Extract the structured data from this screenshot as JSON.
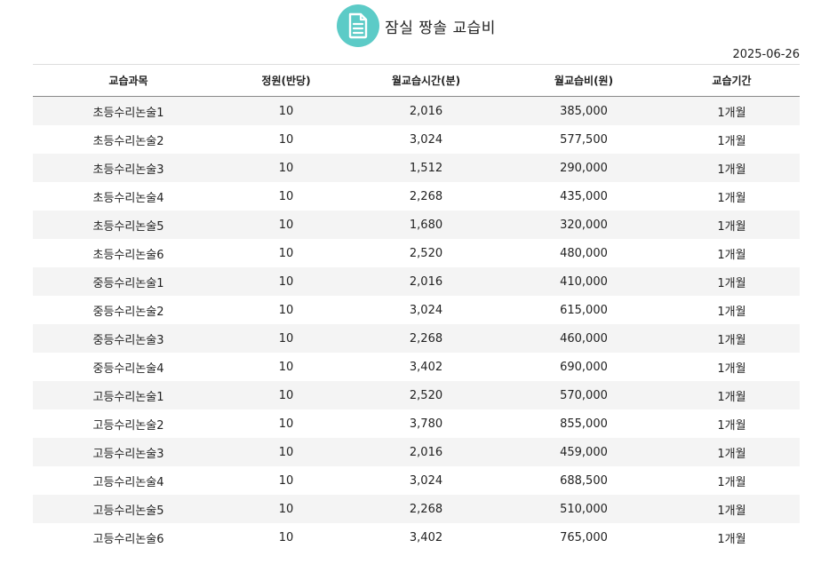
{
  "header": {
    "title": "잠실 짱솔 교습비",
    "icon": "document-icon",
    "accent_color": "#5ccbc7"
  },
  "date": "2025-06-26",
  "table": {
    "columns": [
      "교습과목",
      "정원(반당)",
      "월교습시간(분)",
      "월교습비(원)",
      "교습기간"
    ],
    "rows": [
      [
        "초등수리논술1",
        "10",
        "2,016",
        "385,000",
        "1개월"
      ],
      [
        "초등수리논술2",
        "10",
        "3,024",
        "577,500",
        "1개월"
      ],
      [
        "초등수리논술3",
        "10",
        "1,512",
        "290,000",
        "1개월"
      ],
      [
        "초등수리논술4",
        "10",
        "2,268",
        "435,000",
        "1개월"
      ],
      [
        "초등수리논술5",
        "10",
        "1,680",
        "320,000",
        "1개월"
      ],
      [
        "초등수리논술6",
        "10",
        "2,520",
        "480,000",
        "1개월"
      ],
      [
        "중등수리논술1",
        "10",
        "2,016",
        "410,000",
        "1개월"
      ],
      [
        "중등수리논술2",
        "10",
        "3,024",
        "615,000",
        "1개월"
      ],
      [
        "중등수리논술3",
        "10",
        "2,268",
        "460,000",
        "1개월"
      ],
      [
        "중등수리논술4",
        "10",
        "3,402",
        "690,000",
        "1개월"
      ],
      [
        "고등수리논술1",
        "10",
        "2,520",
        "570,000",
        "1개월"
      ],
      [
        "고등수리논술2",
        "10",
        "3,780",
        "855,000",
        "1개월"
      ],
      [
        "고등수리논술3",
        "10",
        "2,016",
        "459,000",
        "1개월"
      ],
      [
        "고등수리논술4",
        "10",
        "3,024",
        "688,500",
        "1개월"
      ],
      [
        "고등수리논술5",
        "10",
        "2,268",
        "510,000",
        "1개월"
      ],
      [
        "고등수리논술6",
        "10",
        "3,402",
        "765,000",
        "1개월"
      ]
    ]
  }
}
